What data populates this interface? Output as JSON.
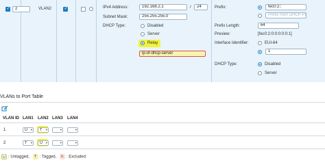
{
  "vlan_row": {
    "vlan_id": "2",
    "vlan_name": "VLAN2",
    "ipv4_label": "IPv4 Address:",
    "ipv4_value": "192.168.2.1",
    "prefix_sep": "/",
    "prefix_len": "24",
    "subnet_label": "Subnet Mask:",
    "subnet_value": "255.255.255.0",
    "dhcp_label": "DHCP Type:",
    "dhcp_options": [
      "Disabled",
      "Server",
      "Relay"
    ],
    "dhcp_selected": "Relay",
    "relay_value": "ip-of-dhcp-server"
  },
  "ipv6": {
    "prefix_label": "Prefix:",
    "prefix_value": "fec0:2::",
    "prefix_placeholder": "Prefix from DHCP-PD",
    "prefix_length_label": "Prefix Length:",
    "prefix_length_value": "64",
    "preview_label": "Preview:",
    "preview_value": "[fec0:2:0:0:0:0:0:1]",
    "interface_id_label": "Interface Identifier:",
    "eui_label": "EUI-64",
    "interface_value": "1",
    "dhcp_type_label": "DHCP Type:",
    "dhcp_options": [
      "Disabled",
      "Server"
    ],
    "dhcp_selected": "Disabled"
  },
  "port_table": {
    "title": "VLANs to Port Table",
    "headers": [
      "VLAN ID",
      "LAN1",
      "LAN2",
      "LAN3",
      "LAN4"
    ],
    "rows": [
      {
        "vlan_id": "1",
        "ports": [
          "U",
          "T",
          "",
          ""
        ]
      },
      {
        "vlan_id": "2",
        "ports": [
          "T",
          "U",
          "",
          ""
        ]
      }
    ]
  },
  "legend": {
    "u_badge": "U",
    "u_text": ": Untagged,",
    "t_badge": "T",
    "t_text": ": Tagged,",
    "e_badge": "E",
    "e_text": ": Excluded"
  },
  "colors": {
    "accent": "#1f7bbf",
    "highlight": "#f3f33a",
    "band": "#e8f3fb"
  }
}
